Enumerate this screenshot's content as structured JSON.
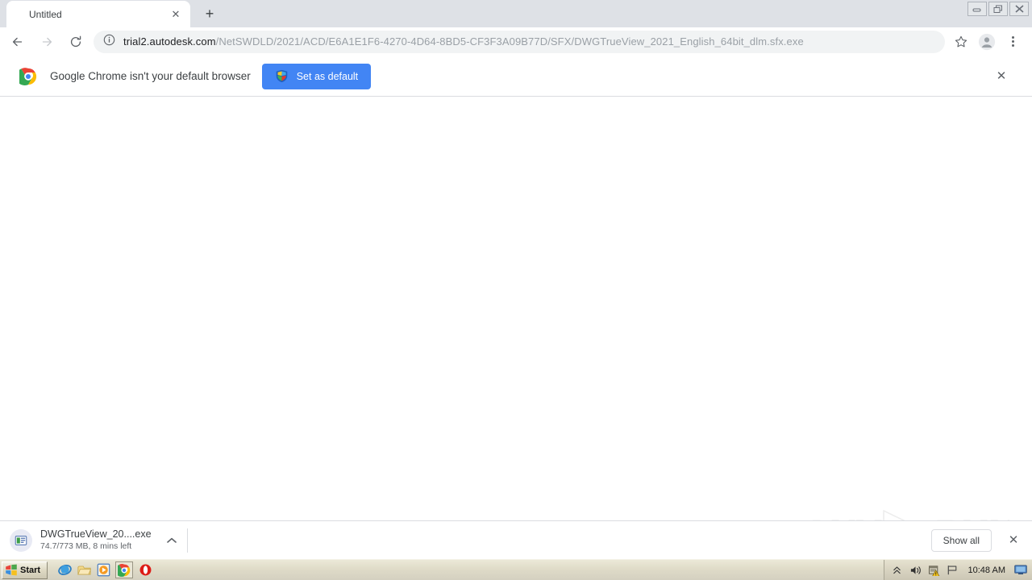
{
  "window": {
    "controls": {
      "minimize": "_",
      "restore": "❐",
      "close": "✕"
    }
  },
  "tabstrip": {
    "tabs": [
      {
        "title": "Untitled",
        "close_label": "✕"
      }
    ],
    "new_tab_label": "+"
  },
  "toolbar": {
    "back_label": "Back",
    "forward_label": "Forward",
    "reload_label": "Reload",
    "omnibox": {
      "info_icon": "info-circle-icon",
      "host": "trial2.autodesk.com",
      "path": "/NetSWDLD/2021/ACD/E6A1E1F6-4270-4D64-8BD5-CF3F3A09B77D/SFX/DWGTrueView_2021_English_64bit_dlm.sfx.exe",
      "full_url": "trial2.autodesk.com/NetSWDLD/2021/ACD/E6A1E1F6-4270-4D64-8BD5-CF3F3A09B77D/SFX/DWGTrueView_2021_English_64bit_dlm.sfx.exe"
    },
    "bookmark_label": "Bookmark this page",
    "profile_label": "Profile",
    "menu_label": "Customize and control Google Chrome"
  },
  "infobar": {
    "logo": "chrome-logo-icon",
    "message": "Google Chrome isn't your default browser",
    "button_label": "Set as default",
    "button_icon": "windows-shield-icon",
    "button_color": "#4285f4",
    "close_label": "✕"
  },
  "download_shelf": {
    "item": {
      "icon": "file-exe-icon",
      "filename": "DWGTrueView_20....exe",
      "status": "74.7/773 MB, 8 mins left",
      "downloaded": "74.7",
      "total": "773 MB",
      "time_left": "8 mins left",
      "menu_label": "Show more options"
    },
    "show_all_label": "Show all",
    "close_label": "✕"
  },
  "watermark": {
    "text_left": "ANY",
    "text_right": "RUN"
  },
  "taskbar": {
    "start_label": "Start",
    "quick_launch": [
      {
        "name": "internet-explorer-icon"
      },
      {
        "name": "file-explorer-icon"
      },
      {
        "name": "media-player-icon"
      },
      {
        "name": "google-chrome-icon",
        "active": true
      },
      {
        "name": "opera-browser-icon"
      }
    ],
    "tray": {
      "show_hidden_label": "«",
      "volume_icon": "volume-icon",
      "security_icon": "security-alert-icon",
      "network_icon": "network-icon",
      "time": "10:48 AM",
      "desktop_icon": "show-desktop-icon"
    }
  }
}
